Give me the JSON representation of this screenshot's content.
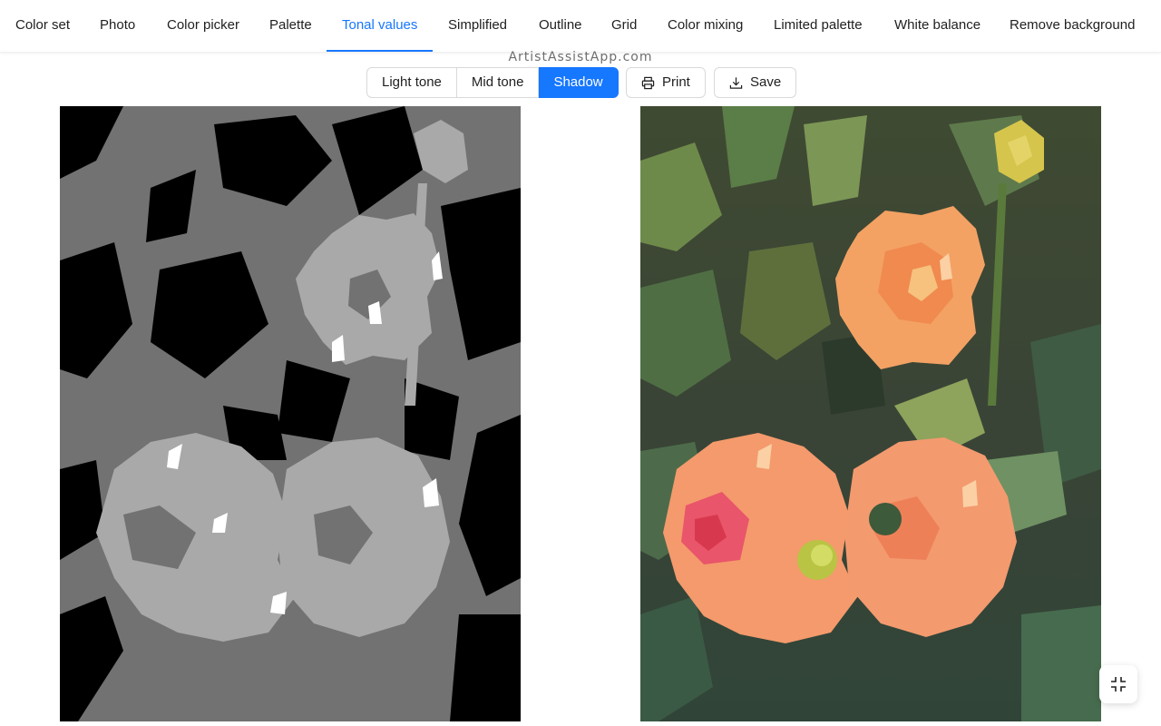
{
  "tabs": [
    {
      "label": "Color set"
    },
    {
      "label": "Photo"
    },
    {
      "label": "Color picker"
    },
    {
      "label": "Palette"
    },
    {
      "label": "Tonal values",
      "active": true
    },
    {
      "label": "Simplified"
    },
    {
      "label": "Outline"
    },
    {
      "label": "Grid"
    },
    {
      "label": "Color mixing"
    },
    {
      "label": "Limited palette"
    },
    {
      "label": "White balance"
    },
    {
      "label": "Remove background"
    }
  ],
  "brand": "ArtistAssistApp.com",
  "tone_selector": {
    "options": [
      "Light tone",
      "Mid tone",
      "Shadow"
    ],
    "selected": "Shadow"
  },
  "actions": {
    "print_label": "Print",
    "save_label": "Save"
  },
  "icons": {
    "print": "printer-icon",
    "save": "download-icon",
    "fullscreen": "collapse-fullscreen-icon"
  },
  "colors": {
    "accent": "#1677ff",
    "text": "#1f1f1f",
    "border": "#d9d9d9",
    "brand_text": "#6e6e6e",
    "tonal_shadow": "#000000",
    "tonal_mid": "#727272",
    "tonal_light": "#a9a9a9",
    "tonal_highlight": "#ffffff"
  }
}
